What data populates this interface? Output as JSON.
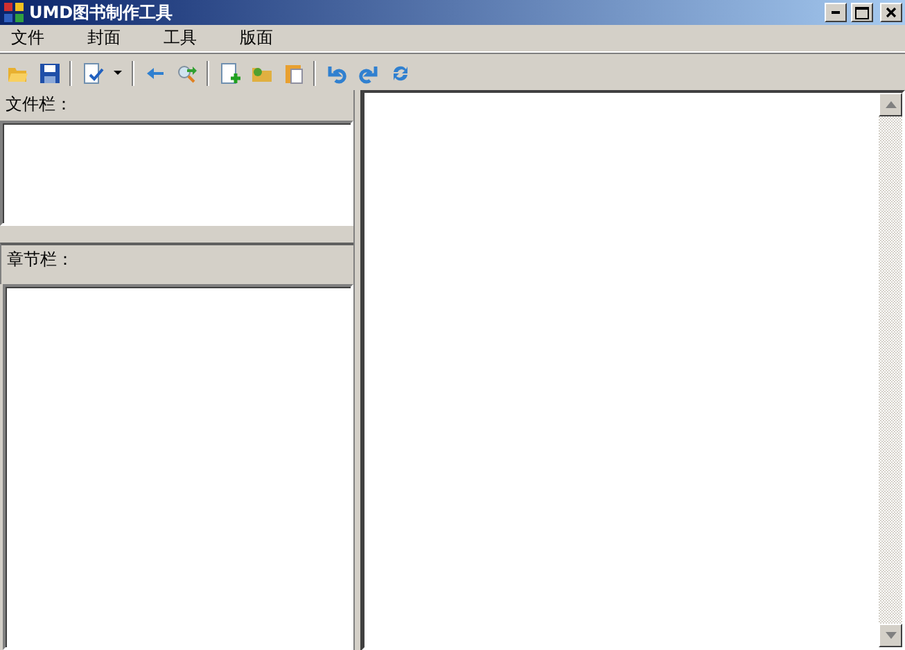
{
  "window": {
    "title": "UMD图书制作工具"
  },
  "menu": [
    "文件",
    "封面",
    "工具",
    "版面"
  ],
  "file_panel": {
    "label": "文件栏："
  },
  "chapter_panel": {
    "label": "章节栏："
  }
}
